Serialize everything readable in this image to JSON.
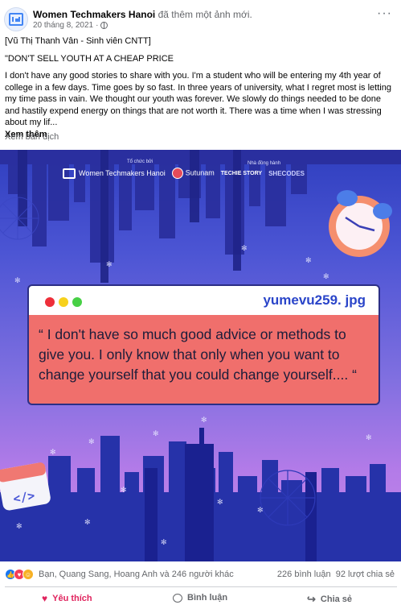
{
  "post": {
    "page_name": "Women Techmakers Hanoi",
    "action": "đã thêm một ảnh mới.",
    "timestamp": "20 tháng 8, 2021",
    "meta_separator": "·",
    "text_lines": {
      "line1": "[Vũ Thị Thanh Vân - Sinh viên CNTT]",
      "line2": "\"DON'T SELL YOUTH AT A CHEAP PRICE",
      "line3": "I don't have any good stories to share with you. I'm a student who will be entering my 4th year of college in a few days. Time goes by so fast. In three years of university, what I regret most is letting my time pass in vain. We thought our youth was forever. We slowly do things needed to be done and hastily expend energy on things that are not worth it. There was a time when I was stressing about my lif..."
    },
    "see_more": "Xem thêm",
    "translate": "Xem bản dịch"
  },
  "image": {
    "brand_main": "Women Techmakers Hanoi",
    "organized_by": "Tổ chức bởi",
    "organizer": "Sutunam",
    "sponsor_label": "Nhà đồng hành",
    "sponsor1": "TECHIE STORY",
    "sponsor2": "SHECODES",
    "window_title": "yumevu259. jpg",
    "quote": "“ I don't have so much good advice or methods to give you. I only know that only when you want to change yourself that you could change yourself.... “"
  },
  "stats": {
    "reactors": "Bạn, Quang Sang, Hoang Anh và 246 người khác",
    "comments": "226 bình luận",
    "shares": "92 lượt chia sẻ"
  },
  "actions": {
    "like": "Yêu thích",
    "comment": "Bình luận",
    "share": "Chia sẻ"
  },
  "colors": {
    "like_active": "#e0245e",
    "accent_blue": "#1877f2",
    "quote_box": "#f06f6c"
  }
}
